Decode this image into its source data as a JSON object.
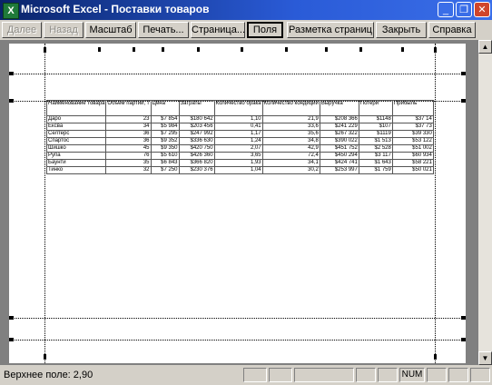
{
  "window": {
    "icon_letter": "X",
    "title": "Microsoft Excel - Поставки товаров",
    "minimize_glyph": "_",
    "maximize_glyph": "❐",
    "close_glyph": "✕"
  },
  "toolbar": {
    "next_label": "Далее",
    "back_label": "Назад",
    "zoom_label": "Масштаб",
    "print_label": "Печать...",
    "page_label": "Страница...",
    "margins_label": "Поля",
    "page_break_label": "Разметка страниц",
    "close_label": "Закрыть",
    "help_label": "Справка"
  },
  "sheet": {
    "headers": [
      "Наименование товара",
      "Объем партии, т",
      "Цена",
      "Затраты",
      "Количество брака",
      "Количество кондиции",
      "Выручка",
      "Потери",
      "Прибыль"
    ],
    "rows": [
      [
        "Даро",
        "23",
        "$7 854",
        "$180 642",
        "1,10",
        "21,9",
        "$208 366",
        "$1148",
        "$37 14"
      ],
      [
        "Ексва",
        "34",
        "$5 984",
        "$203 456",
        "0,41",
        "33,6",
        "$241 229",
        "$107",
        "$37 73"
      ],
      [
        "Селтерс",
        "36",
        "$7 295",
        "$247 992",
        "1,17",
        "35,6",
        "$267 322",
        "$1119",
        "$39 330"
      ],
      [
        "Спартос",
        "36",
        "$9 352",
        "$336 630",
        "1,24",
        "34,8",
        "$390 022",
        "$1 513",
        "$53 122"
      ],
      [
        "Шишко",
        "45",
        "$9 350",
        "$420 750",
        "2,07",
        "42,9",
        "$451 752",
        "$2 528",
        "$51 002"
      ],
      [
        "Рупа",
        "76",
        "$5 610",
        "$426 360",
        "3,65",
        "72,4",
        "$450 294",
        "$3 117",
        "$60 934"
      ],
      [
        "Баунти",
        "35",
        "$6 843",
        "$366 820",
        "1,93",
        "34,1",
        "$424 741",
        "$1 643",
        "$58 221"
      ],
      [
        "Тинко",
        "32",
        "$7 250",
        "$230 376",
        "1,04",
        "30,2",
        "$253 997",
        "$1 759",
        "$50 021"
      ]
    ]
  },
  "statusbar": {
    "text": "Верхнее поле: 2,90",
    "num_indicator": "NUM"
  },
  "scrollbar": {
    "up_glyph": "▲",
    "down_glyph": "▼"
  }
}
